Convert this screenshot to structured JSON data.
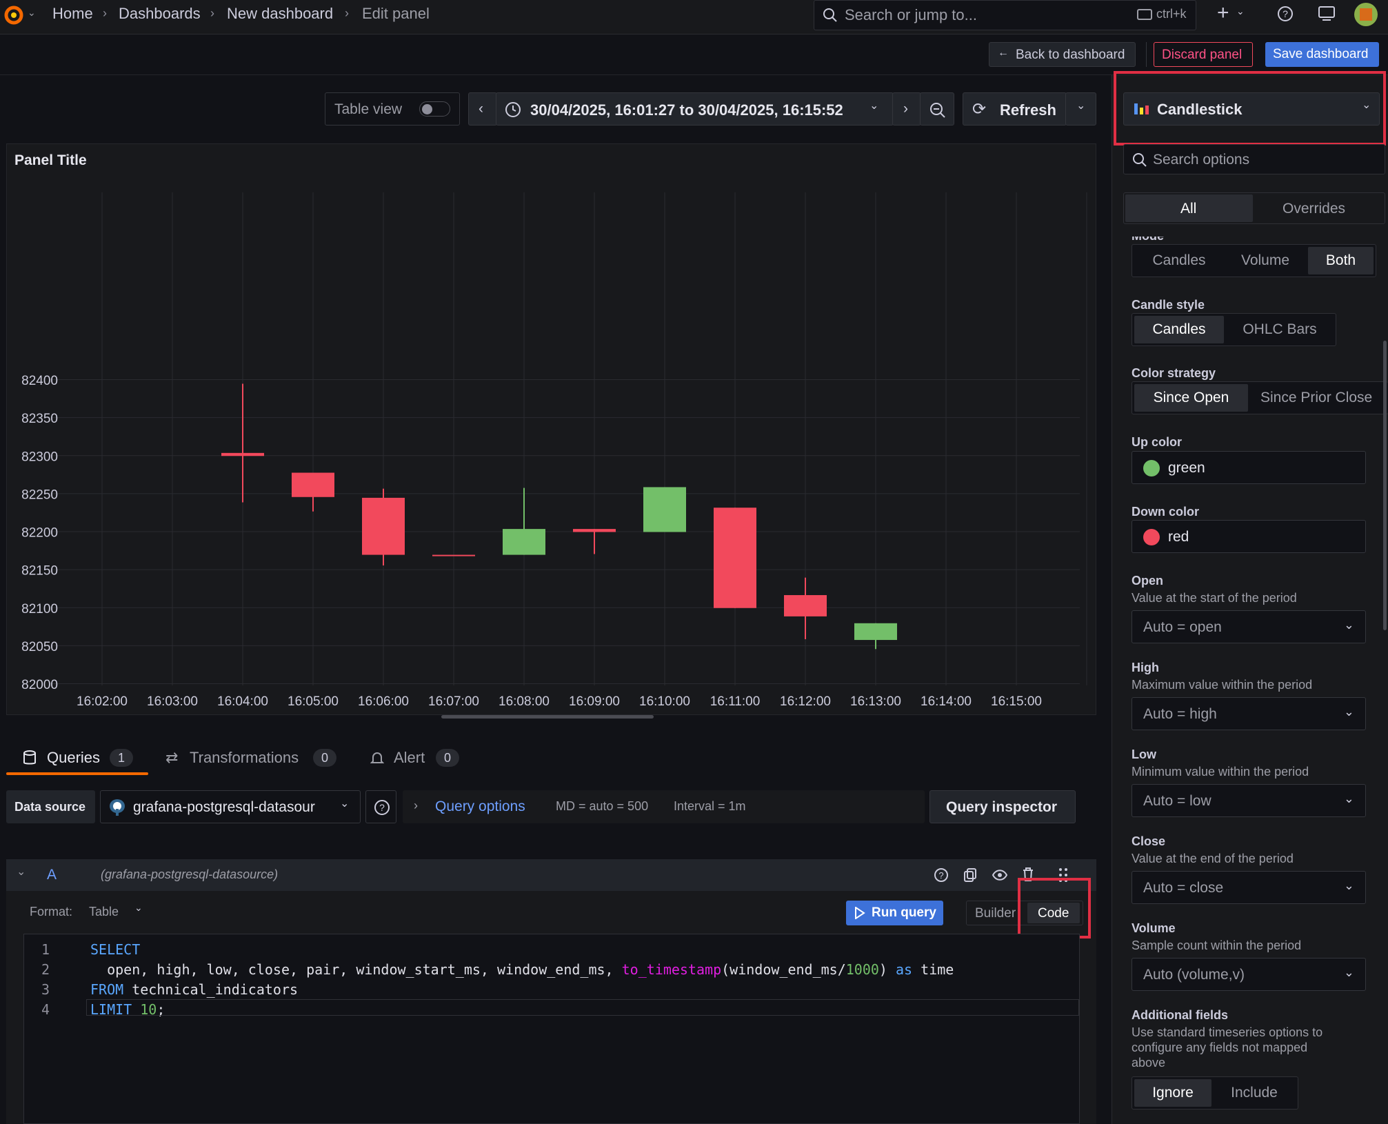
{
  "breadcrumb": {
    "home": "Home",
    "dashboards": "Dashboards",
    "new_dashboard": "New dashboard",
    "edit_panel": "Edit panel"
  },
  "search": {
    "placeholder": "Search or jump to...",
    "shortcut": "ctrl+k"
  },
  "actions": {
    "back": "Back to dashboard",
    "discard": "Discard panel",
    "save": "Save dashboard"
  },
  "toolbar": {
    "table_view": "Table view",
    "time_range": "30/04/2025, 16:01:27 to 30/04/2025, 16:15:52",
    "refresh": "Refresh"
  },
  "panel": {
    "title": "Panel Title"
  },
  "chart_data": {
    "type": "candlestick",
    "title": "Panel Title",
    "x": [
      "16:02:00",
      "16:03:00",
      "16:04:00",
      "16:05:00",
      "16:06:00",
      "16:07:00",
      "16:08:00",
      "16:09:00",
      "16:10:00",
      "16:11:00",
      "16:12:00",
      "16:13:00",
      "16:14:00",
      "16:15:00"
    ],
    "ylim": [
      82000,
      82420
    ],
    "yticks": [
      82000,
      82050,
      82100,
      82150,
      82200,
      82250,
      82300,
      82350,
      82400
    ],
    "grid": true,
    "up_color": "#73bf69",
    "down_color": "#f2495c",
    "candles": [
      {
        "t": "16:04:00",
        "open": 82304,
        "high": 82395,
        "low": 82239,
        "close": 82300
      },
      {
        "t": "16:05:00",
        "open": 82278,
        "high": 82278,
        "low": 82227,
        "close": 82246
      },
      {
        "t": "16:06:00",
        "open": 82245,
        "high": 82257,
        "low": 82156,
        "close": 82170
      },
      {
        "t": "16:07:00",
        "open": 82170,
        "high": 82170,
        "low": 82170,
        "close": 82169
      },
      {
        "t": "16:08:00",
        "open": 82170,
        "high": 82258,
        "low": 82170,
        "close": 82204
      },
      {
        "t": "16:09:00",
        "open": 82204,
        "high": 82204,
        "low": 82171,
        "close": 82200
      },
      {
        "t": "16:10:00",
        "open": 82200,
        "high": 82259,
        "low": 82200,
        "close": 82259
      },
      {
        "t": "16:11:00",
        "open": 82232,
        "high": 82232,
        "low": 82100,
        "close": 82100
      },
      {
        "t": "16:12:00",
        "open": 82117,
        "high": 82140,
        "low": 82059,
        "close": 82089
      },
      {
        "t": "16:13:00",
        "open": 82058,
        "high": 82080,
        "low": 82046,
        "close": 82080
      }
    ]
  },
  "tabs": {
    "queries": "Queries",
    "queries_count": "1",
    "transformations": "Transformations",
    "transformations_count": "0",
    "alert": "Alert",
    "alert_count": "0"
  },
  "datasource": {
    "label": "Data source",
    "name": "grafana-postgresql-datasour",
    "query_options": "Query options",
    "md": "MD = auto = 500",
    "interval": "Interval = 1m",
    "inspector": "Query inspector"
  },
  "query": {
    "ref": "A",
    "ds": "(grafana-postgresql-datasource)",
    "format_label": "Format:",
    "format_value": "Table",
    "run": "Run query",
    "builder": "Builder",
    "code": "Code",
    "lines": [
      {
        "n": "1",
        "parts": [
          {
            "c": "kw",
            "t": "SELECT"
          }
        ]
      },
      {
        "n": "2",
        "parts": [
          {
            "c": "",
            "t": "  open, high, low, close, pair, window_start_ms, window_end_ms, "
          },
          {
            "c": "fn",
            "t": "to_timestamp"
          },
          {
            "c": "",
            "t": "(window_end_ms/"
          },
          {
            "c": "nm",
            "t": "1000"
          },
          {
            "c": "",
            "t": ") "
          },
          {
            "c": "kw",
            "t": "as"
          },
          {
            "c": "",
            "t": " time"
          }
        ]
      },
      {
        "n": "3",
        "parts": [
          {
            "c": "kw",
            "t": "FROM"
          },
          {
            "c": "",
            "t": " technical_indicators"
          }
        ]
      },
      {
        "n": "4",
        "parts": [
          {
            "c": "kw",
            "t": "LIMIT"
          },
          {
            "c": "",
            "t": " "
          },
          {
            "c": "nm",
            "t": "10"
          },
          {
            "c": "",
            "t": ";"
          }
        ]
      }
    ]
  },
  "viz": {
    "name": "Candlestick",
    "search_placeholder": "Search options",
    "tab_all": "All",
    "tab_overrides": "Overrides"
  },
  "options": {
    "mode_label": "Mode",
    "mode": [
      "Candles",
      "Volume",
      "Both"
    ],
    "candle_style_label": "Candle style",
    "candle_style": [
      "Candles",
      "OHLC Bars"
    ],
    "color_strategy_label": "Color strategy",
    "color_strategy": [
      "Since Open",
      "Since Prior Close"
    ],
    "up_color_label": "Up color",
    "up_color": "green",
    "down_color_label": "Down color",
    "down_color": "red",
    "open_label": "Open",
    "open_desc": "Value at the start of the period",
    "open_value": "Auto = open",
    "high_label": "High",
    "high_desc": "Maximum value within the period",
    "high_value": "Auto = high",
    "low_label": "Low",
    "low_desc": "Minimum value within the period",
    "low_value": "Auto = low",
    "close_label": "Close",
    "close_desc": "Value at the end of the period",
    "close_value": "Auto = close",
    "volume_label": "Volume",
    "volume_desc": "Sample count within the period",
    "volume_value": "Auto (volume,v)",
    "additional_label": "Additional fields",
    "additional_desc1": "Use standard timeseries options to",
    "additional_desc2": "configure any fields not mapped",
    "additional_desc3": "above",
    "additional": [
      "Ignore",
      "Include"
    ]
  }
}
